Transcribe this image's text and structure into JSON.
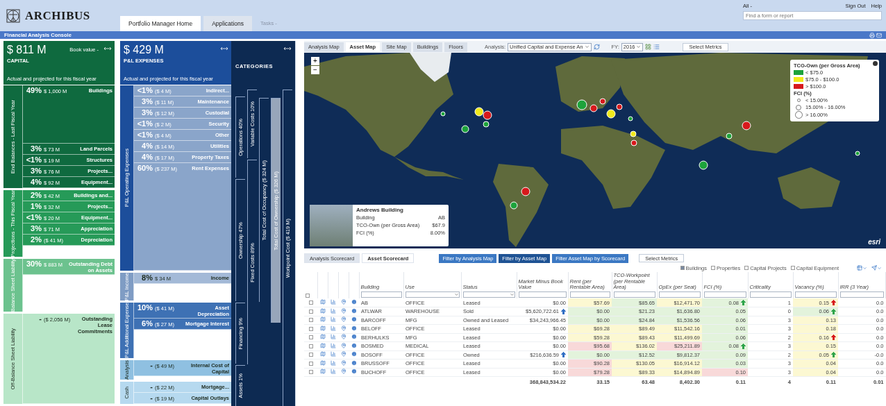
{
  "header": {
    "logo": "ARCHIBUS",
    "tabs": [
      {
        "label": "Portfolio Manager Home",
        "selected": true
      },
      {
        "label": "Applications",
        "selected": false
      }
    ],
    "tasks": "Tasks -",
    "user": "All -",
    "links": [
      "Sign Out",
      "Help"
    ],
    "search": {
      "placeholder": "Find a form or report"
    }
  },
  "console_title": "Financial Analysis Console",
  "capital": {
    "amount": "$ 811 M",
    "title": "CAPITAL",
    "menu": "Book value -",
    "note": "Actual and projected for this fiscal year",
    "groups": [
      {
        "label": "End Balances - Last Fiscal Year",
        "color": "#0f6a3f",
        "rows": [
          {
            "kind": "tall",
            "percent": "49%",
            "amount": "$ 1,000 M",
            "label": "Buildings"
          },
          {
            "kind": "row",
            "percent": "3%",
            "amount": "$ 73 M",
            "label": "Land Parcels"
          },
          {
            "kind": "row",
            "percent": "<1%",
            "amount": "$ 19 M",
            "label": "Structures"
          },
          {
            "kind": "row",
            "percent": "3%",
            "amount": "$ 76 M",
            "label": "Projects..."
          },
          {
            "kind": "row",
            "percent": "4%",
            "amount": "$ 92 M",
            "label": "Equipment..."
          }
        ]
      },
      {
        "label": "Projections - This Fiscal Year",
        "color": "#269a58",
        "rows": [
          {
            "kind": "row",
            "percent": "2%",
            "amount": "$ 42 M",
            "label": "Buildings and..."
          },
          {
            "kind": "row",
            "percent": "1%",
            "amount": "$ 32 M",
            "label": "Projects..."
          },
          {
            "kind": "row",
            "percent": "<1%",
            "amount": "$ 20 M",
            "label": "Equipment..."
          },
          {
            "kind": "row",
            "percent": "3%",
            "amount": "$ 71 M",
            "label": "Appreciation"
          },
          {
            "kind": "row",
            "percent": "2%",
            "amount": "($ 41 M)",
            "label": "Depreciation"
          }
        ]
      },
      {
        "label": "Balance Sheet Liability",
        "color": "#6cc28e",
        "rows": [
          {
            "kind": "row",
            "percent": "30%",
            "amount": "$ 883 M",
            "label": "Outstanding Debt on Assets"
          }
        ]
      },
      {
        "label": "Off-Balance Sheet Liability",
        "color": "#b8e6c8",
        "rows": [
          {
            "kind": "tall",
            "percent": "-",
            "amount": "($ 2,056 M)",
            "label": "Outstanding Lease Commitments"
          }
        ]
      }
    ]
  },
  "pnl": {
    "amount": "$ 429 M",
    "title": "P&L EXPENSES",
    "note": "Actual and projected for this fiscal year",
    "groups": [
      {
        "label": "P&L Operating Expenses",
        "color": "#8aa5ca",
        "band": {
          "color": "#1c4e9b"
        },
        "rows": [
          {
            "kind": "row",
            "percent": "<1%",
            "amount": "($ 4 M)",
            "label": "Indirect..."
          },
          {
            "kind": "row",
            "percent": "3%",
            "amount": "($ 11 M)",
            "label": "Maintenance"
          },
          {
            "kind": "row",
            "percent": "3%",
            "amount": "($ 12 M)",
            "label": "Custodial"
          },
          {
            "kind": "row",
            "percent": "<1%",
            "amount": "($ 2 M)",
            "label": "Security"
          },
          {
            "kind": "row",
            "percent": "<1%",
            "amount": "($ 4 M)",
            "label": "Other"
          },
          {
            "kind": "row",
            "percent": "4%",
            "amount": "($ 14 M)",
            "label": "Utilities"
          },
          {
            "kind": "row",
            "percent": "4%",
            "amount": "($ 17 M)",
            "label": "Property Taxes"
          },
          {
            "kind": "tall",
            "percent": "60%",
            "amount": "($ 237 M)",
            "label": "Rent Expenses"
          }
        ]
      },
      {
        "label": "P&L Income",
        "color": "#a3b9d7",
        "band": {
          "color": "#7f9cc4"
        },
        "rows": [
          {
            "kind": "row",
            "percent": "8%",
            "amount": "$ 34 M",
            "label": "Income"
          }
        ]
      },
      {
        "label": "P&L Additional Expense",
        "color": "#3e71b4",
        "rows": [
          {
            "kind": "row",
            "percent": "10%",
            "amount": "($ 41 M)",
            "label": "Asset Depreciation"
          },
          {
            "kind": "row",
            "percent": "6%",
            "amount": "($ 27 M)",
            "label": "Mortgage Interest"
          }
        ]
      },
      {
        "label": "Analysis",
        "color": "#8fc0e1",
        "rows": [
          {
            "kind": "row",
            "percent": "-",
            "amount": "($ 49 M)",
            "label": "Internal Cost of Capital"
          }
        ]
      },
      {
        "label": "Cash",
        "color": "#b6d9ef",
        "rows": [
          {
            "kind": "row",
            "percent": "-",
            "amount": "($ 22 M)",
            "label": "Mortgage..."
          },
          {
            "kind": "row",
            "percent": "-",
            "amount": "($ 19 M)",
            "label": "Capital Outlays"
          }
        ]
      }
    ]
  },
  "categories": {
    "title": "CATEGORIES",
    "columns": [
      {
        "kind": "bracket",
        "segments": [
          "Operations 40%",
          "Ownership 47%",
          "Financing 9%",
          "Assets 1%"
        ]
      },
      {
        "kind": "bracket",
        "segments": [
          "Variable Costs 10%",
          "Fixed Costs 89%"
        ]
      },
      {
        "kind": "bracket",
        "segments": [
          "Total Cost of Occupancy ($ 324 M)"
        ]
      },
      {
        "kind": "bar",
        "segments": [
          "Total Cost of Ownership ($ 326 M)"
        ]
      },
      {
        "kind": "bracket",
        "segments": [
          "Workpoint Cost ($ 419 M)"
        ]
      }
    ]
  },
  "map_toolbar": {
    "tabs": [
      {
        "label": "Analysis Map",
        "selected": false
      },
      {
        "label": "Asset Map",
        "selected": true
      },
      {
        "label": "Site Map",
        "selected": false
      },
      {
        "label": "Buildings",
        "selected": false
      },
      {
        "label": "Floors",
        "selected": false
      }
    ],
    "analysis_label": "Analysis:",
    "analysis_value": "Unified Capital and Expense An",
    "fy_label": "FY:",
    "fy_value": "2016",
    "metrics_button": "Select Metrics"
  },
  "map": {
    "legend": {
      "title": "TCO-Own (per Gross Area)",
      "items": [
        {
          "label": "< $75.0",
          "color": "#1da33b"
        },
        {
          "label": "$75.0 - $100.0",
          "color": "#f1ea1c"
        },
        {
          "label": "> $100.0",
          "color": "#d7191c"
        }
      ],
      "fci_title": "FCI (%)",
      "fci_items": [
        {
          "label": "< 15.00%",
          "kind": "small"
        },
        {
          "label": "15.00% - 16.00%",
          "kind": "medium"
        },
        {
          "label": "> 16.00%",
          "kind": "large"
        }
      ]
    },
    "zoom": [
      "+",
      "−"
    ],
    "popup": {
      "title": "Andrews Building",
      "fields": [
        {
          "label": "Building",
          "value": "AB"
        },
        {
          "label": "TCO-Own (per Gross Area)",
          "value": "$67.9"
        },
        {
          "label": "FCI (%)",
          "value": "8.00%"
        }
      ]
    },
    "attribution": "esri"
  },
  "scorecard": {
    "tabs": [
      {
        "label": "Analysis Scorecard",
        "selected": false
      },
      {
        "label": "Asset Scorecard",
        "selected": true
      }
    ],
    "filters": [
      {
        "label": "Filter by Analysis Map",
        "selected": false
      },
      {
        "label": "Filter by Asset Map",
        "selected": true
      },
      {
        "label": "Filter Asset Map by Scorecard",
        "selected": false
      }
    ],
    "metrics_button": "Select Metrics",
    "types": [
      {
        "label": "Buildings",
        "checked": true
      },
      {
        "label": "Properties",
        "checked": false
      },
      {
        "label": "Capital Projects",
        "checked": false
      },
      {
        "label": "Capital Equipment",
        "checked": false
      }
    ]
  },
  "table": {
    "selected_all": false,
    "columns": [
      {
        "label": "Building",
        "kind": "text"
      },
      {
        "label": "Use",
        "kind": "choice"
      },
      {
        "label": "Status",
        "kind": "choice"
      },
      {
        "label": "Market Minus Book Value",
        "kind": "number"
      },
      {
        "label": "Rent (per Rentable Area)",
        "kind": "number"
      },
      {
        "label": "TCO-Workpoint (per Rentable Area)",
        "kind": "number"
      },
      {
        "label": "OpEx (per Seat)",
        "kind": "number"
      },
      {
        "label": "FCI (%)",
        "kind": "number"
      },
      {
        "label": "Criticality",
        "kind": "number"
      },
      {
        "label": "Vacancy (%)",
        "kind": "number"
      },
      {
        "label": "IRR (3 Year)",
        "kind": "number"
      }
    ],
    "rows": [
      {
        "selected": false,
        "cells": [
          {
            "text": "AB"
          },
          {
            "text": "OFFICE"
          },
          {
            "text": "Leased"
          },
          {
            "text": "$0.00"
          },
          {
            "text": "$57.69",
            "color": "#fcf8d2"
          },
          {
            "text": "$85.65",
            "color": "#e3f3dc"
          },
          {
            "text": "$12,471.70",
            "color": "#fcf8d2"
          },
          {
            "text": "0.08",
            "color": "#e3f3dc",
            "arrow": {
              "color": "#2ea44a"
            }
          },
          {
            "text": "1"
          },
          {
            "text": "0.15",
            "color": "#fcf8d2",
            "arrow": {
              "color": "#d7191c"
            }
          },
          {
            "text": "0.0"
          }
        ]
      },
      {
        "selected": false,
        "cells": [
          {
            "text": "ATLWAR"
          },
          {
            "text": "WAREHOUSE"
          },
          {
            "text": "Sold"
          },
          {
            "text": "$5,620,722.61",
            "arrow": {
              "color": "#2f6fc4"
            }
          },
          {
            "text": "$0.00",
            "color": "#e3f3dc"
          },
          {
            "text": "$21.23",
            "color": "#e3f3dc"
          },
          {
            "text": "$1,636.80",
            "color": "#e3f3dc"
          },
          {
            "text": "0.05",
            "color": "#e3f3dc"
          },
          {
            "text": "0"
          },
          {
            "text": "0.06",
            "color": "#e3f3dc",
            "arrow": {
              "color": "#2ea44a"
            }
          },
          {
            "text": "0.0"
          }
        ]
      },
      {
        "selected": false,
        "cells": [
          {
            "text": "BARCOFF"
          },
          {
            "text": "MFG"
          },
          {
            "text": "Owned and Leased"
          },
          {
            "text": "$34,243,966.45"
          },
          {
            "text": "$0.00",
            "color": "#e3f3dc"
          },
          {
            "text": "$24.84",
            "color": "#e3f3dc"
          },
          {
            "text": "$1,536.56",
            "color": "#e3f3dc"
          },
          {
            "text": "0.06",
            "color": "#e3f3dc"
          },
          {
            "text": "3"
          },
          {
            "text": "0.13",
            "color": "#fcf8d2"
          },
          {
            "text": "0.0"
          }
        ]
      },
      {
        "selected": false,
        "cells": [
          {
            "text": "BELOFF"
          },
          {
            "text": "OFFICE"
          },
          {
            "text": "Leased"
          },
          {
            "text": "$0.00"
          },
          {
            "text": "$69.28",
            "color": "#fcf8d2"
          },
          {
            "text": "$89.49",
            "color": "#fcf8d2"
          },
          {
            "text": "$11,542.16",
            "color": "#fcf8d2"
          },
          {
            "text": "0.01",
            "color": "#e3f3dc"
          },
          {
            "text": "3"
          },
          {
            "text": "0.18",
            "color": "#fcf8d2"
          },
          {
            "text": "0.0"
          }
        ]
      },
      {
        "selected": false,
        "cells": [
          {
            "text": "BERHULKS"
          },
          {
            "text": "MFG"
          },
          {
            "text": "Leased"
          },
          {
            "text": "$0.00"
          },
          {
            "text": "$59.28",
            "color": "#fcf8d2"
          },
          {
            "text": "$89.43",
            "color": "#fcf8d2"
          },
          {
            "text": "$11,499.69",
            "color": "#fcf8d2"
          },
          {
            "text": "0.06",
            "color": "#e3f3dc"
          },
          {
            "text": "2"
          },
          {
            "text": "0.16",
            "color": "#fcf8d2",
            "arrow": {
              "color": "#d7191c"
            }
          },
          {
            "text": "0.0"
          }
        ]
      },
      {
        "selected": false,
        "cells": [
          {
            "text": "BOSMED"
          },
          {
            "text": "MEDICAL"
          },
          {
            "text": "Leased"
          },
          {
            "text": "$0.00"
          },
          {
            "text": "$95.68",
            "color": "#f8d9d9"
          },
          {
            "text": "$136.02",
            "color": "#fcf8d2"
          },
          {
            "text": "$25,211.89",
            "color": "#f8d9d9"
          },
          {
            "text": "0.08",
            "color": "#e3f3dc",
            "arrow": {
              "color": "#2ea44a"
            }
          },
          {
            "text": "3"
          },
          {
            "text": "0.15",
            "color": "#fcf8d2"
          },
          {
            "text": "0.0"
          }
        ]
      },
      {
        "selected": false,
        "cells": [
          {
            "text": "BOSOFF"
          },
          {
            "text": "OFFICE"
          },
          {
            "text": "Owned"
          },
          {
            "text": "$216,636.59",
            "arrow": {
              "color": "#2f6fc4"
            }
          },
          {
            "text": "$0.00",
            "color": "#e3f3dc"
          },
          {
            "text": "$12.52",
            "color": "#e3f3dc"
          },
          {
            "text": "$9,812.37",
            "color": "#e3f3dc"
          },
          {
            "text": "0.09",
            "color": "#e3f3dc"
          },
          {
            "text": "2"
          },
          {
            "text": "0.05",
            "color": "#fcf8d2",
            "arrow": {
              "color": "#2ea44a"
            }
          },
          {
            "text": "-0.0"
          }
        ]
      },
      {
        "selected": false,
        "cells": [
          {
            "text": "BRUSSOFF"
          },
          {
            "text": "OFFICE"
          },
          {
            "text": "Leased"
          },
          {
            "text": "$0.00"
          },
          {
            "text": "$90.28",
            "color": "#f8d9d9"
          },
          {
            "text": "$130.05",
            "color": "#fcf8d2"
          },
          {
            "text": "$16,914.12",
            "color": "#fcf8d2"
          },
          {
            "text": "0.03",
            "color": "#e3f3dc"
          },
          {
            "text": "3"
          },
          {
            "text": "0.04",
            "color": "#fcf8d2"
          },
          {
            "text": "0.0"
          }
        ]
      },
      {
        "selected": false,
        "cells": [
          {
            "text": "BUCHOFF"
          },
          {
            "text": "OFFICE"
          },
          {
            "text": "Leased"
          },
          {
            "text": "$0.00"
          },
          {
            "text": "$79.28",
            "color": "#f8d9d9"
          },
          {
            "text": "$89.33",
            "color": "#fcf8d2"
          },
          {
            "text": "$14,894.89",
            "color": "#fcf8d2"
          },
          {
            "text": "0.10",
            "color": "#f8d9d9"
          },
          {
            "text": "3"
          },
          {
            "text": "0.04",
            "color": "#fcf8d2"
          },
          {
            "text": "0.0"
          }
        ]
      }
    ],
    "totals": [
      "368,843,534.22",
      "33.15",
      "63.48",
      "8,402.30",
      "0.11",
      "4",
      "0.11",
      "0.01"
    ]
  }
}
